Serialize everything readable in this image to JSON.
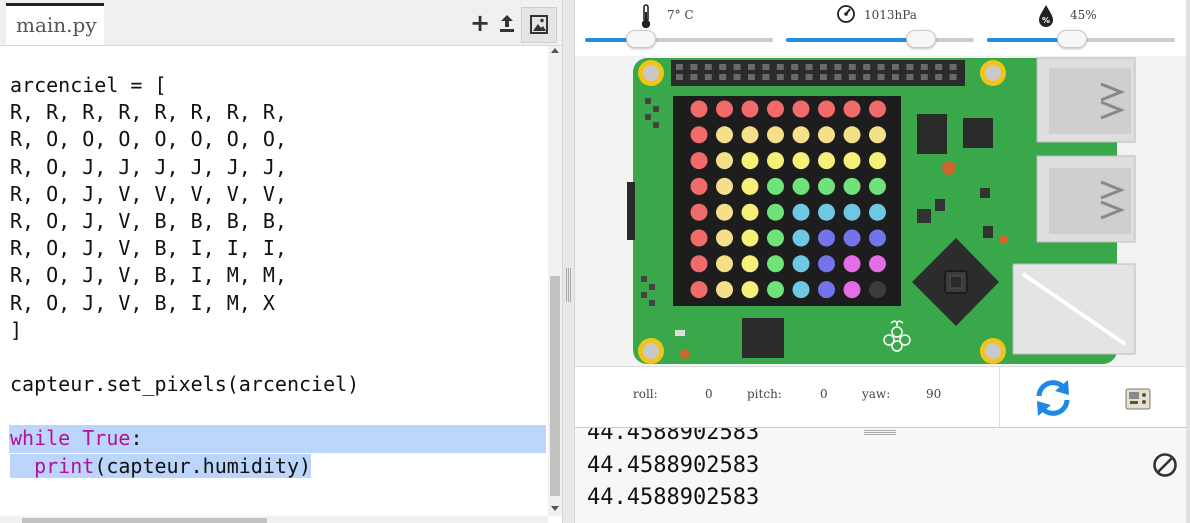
{
  "editor": {
    "tab_label": "main.py",
    "toolbar": {
      "add_icon": "plus-icon",
      "upload_icon": "upload-icon",
      "image_icon": "image-icon"
    },
    "code_lines": [
      "",
      "arcenciel = [",
      "R, R, R, R, R, R, R, R,",
      "R, O, O, O, O, O, O, O,",
      "R, O, J, J, J, J, J, J,",
      "R, O, J, V, V, V, V, V,",
      "R, O, J, V, B, B, B, B,",
      "R, O, J, V, B, I, I, I,",
      "R, O, J, V, B, I, M, M,",
      "R, O, J, V, B, I, M, X",
      "]",
      "",
      "capteur.set_pixels(arcenciel)",
      ""
    ],
    "while_kw": "while",
    "true_kw": "True",
    "colon": ":",
    "print_indent": "  ",
    "print_kw": "print",
    "print_args": "(capteur.humidity)"
  },
  "sensors": {
    "temperature": {
      "icon": "thermometer-icon",
      "value": "7° C",
      "level": 0.3
    },
    "pressure": {
      "icon": "gauge-icon",
      "value": "1013hPa",
      "level": 0.72
    },
    "humidity": {
      "icon": "humidity-drop-icon",
      "value": "45%",
      "level": 0.45
    }
  },
  "led_matrix": {
    "colors": {
      "R": "#f26b6b",
      "O": "#f5e08a",
      "J": "#f4f07a",
      "V": "#6fe27a",
      "B": "#6ec7e3",
      "I": "#7373ea",
      "M": "#e46ee8",
      "X": "#3c3c3c"
    },
    "rows": [
      [
        "R",
        "R",
        "R",
        "R",
        "R",
        "R",
        "R",
        "R"
      ],
      [
        "R",
        "O",
        "O",
        "O",
        "O",
        "O",
        "O",
        "O"
      ],
      [
        "R",
        "O",
        "J",
        "J",
        "J",
        "J",
        "J",
        "J"
      ],
      [
        "R",
        "O",
        "J",
        "V",
        "V",
        "V",
        "V",
        "V"
      ],
      [
        "R",
        "O",
        "J",
        "V",
        "B",
        "B",
        "B",
        "B"
      ],
      [
        "R",
        "O",
        "J",
        "V",
        "B",
        "I",
        "I",
        "I"
      ],
      [
        "R",
        "O",
        "J",
        "V",
        "B",
        "I",
        "M",
        "M"
      ],
      [
        "R",
        "O",
        "J",
        "V",
        "B",
        "I",
        "M",
        "X"
      ]
    ]
  },
  "rotation": {
    "roll_label": "roll:",
    "roll_value": "0",
    "pitch_label": "pitch:",
    "pitch_value": "0",
    "yaw_label": "yaw:",
    "yaw_value": "90",
    "refresh_icon": "refresh-icon",
    "gamepad_icon": "gamepad-icon"
  },
  "output": {
    "lines": [
      "44.4588902583",
      "44.4588902583",
      "44.4588902583"
    ],
    "clear_icon": "clear-output-icon"
  }
}
